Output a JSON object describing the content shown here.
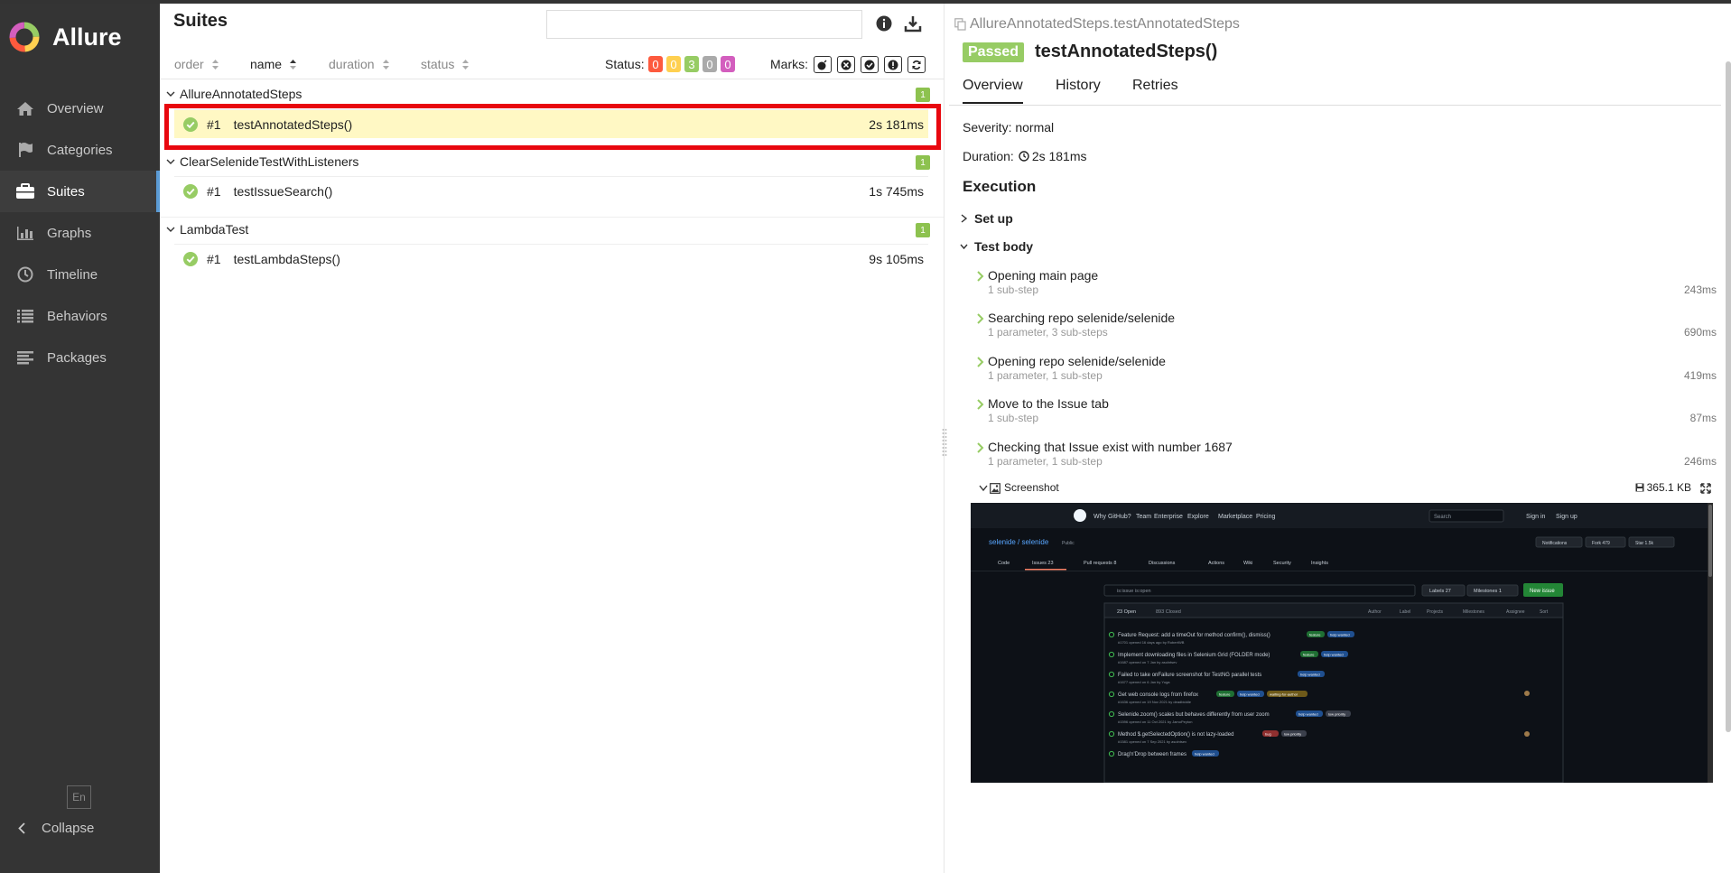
{
  "app": {
    "name": "Allure"
  },
  "sidebar": {
    "items": [
      {
        "label": "Overview",
        "icon": "home-icon",
        "active": false
      },
      {
        "label": "Categories",
        "icon": "flag-icon",
        "active": false
      },
      {
        "label": "Suites",
        "icon": "briefcase-icon",
        "active": true
      },
      {
        "label": "Graphs",
        "icon": "bar-chart-icon",
        "active": false
      },
      {
        "label": "Timeline",
        "icon": "clock-icon",
        "active": false
      },
      {
        "label": "Behaviors",
        "icon": "list-icon",
        "active": false
      },
      {
        "label": "Packages",
        "icon": "align-left-icon",
        "active": false
      }
    ],
    "lang": "En",
    "collapse": "Collapse"
  },
  "suites": {
    "title": "Suites",
    "search_value": "",
    "sort": {
      "order": "order",
      "name": "name",
      "duration": "duration",
      "status": "status"
    },
    "status_label": "Status:",
    "status_counts": [
      {
        "value": "0",
        "color": "#fd5a3e"
      },
      {
        "value": "0",
        "color": "#ffd050"
      },
      {
        "value": "3",
        "color": "#97cc64"
      },
      {
        "value": "0",
        "color": "#aaaaaa"
      },
      {
        "value": "0",
        "color": "#d35ebe"
      }
    ],
    "marks_label": "Marks:",
    "groups": [
      {
        "name": "AllureAnnotatedSteps",
        "count": "1",
        "tests": [
          {
            "num": "#1",
            "name": "testAnnotatedSteps()",
            "duration": "2s 181ms"
          }
        ]
      },
      {
        "name": "ClearSelenideTestWithListeners",
        "count": "1",
        "tests": [
          {
            "num": "#1",
            "name": "testIssueSearch()",
            "duration": "1s 745ms"
          }
        ]
      },
      {
        "name": "LambdaTest",
        "count": "1",
        "tests": [
          {
            "num": "#1",
            "name": "testLambdaSteps()",
            "duration": "9s 105ms"
          }
        ]
      }
    ]
  },
  "detail": {
    "path": "AllureAnnotatedSteps.testAnnotatedSteps",
    "status": "Passed",
    "name": "testAnnotatedSteps()",
    "tabs": [
      "Overview",
      "History",
      "Retries"
    ],
    "severity": "Severity: normal",
    "duration_label": "Duration:",
    "duration": "2s 181ms",
    "execution": "Execution",
    "setup": "Set up",
    "test_body": "Test body",
    "steps": [
      {
        "title": "Opening main page",
        "sub": "1 sub-step",
        "duration": "243ms"
      },
      {
        "title": "Searching repo selenide/selenide",
        "sub": "1 parameter, 3 sub-steps",
        "duration": "690ms"
      },
      {
        "title": "Opening repo selenide/selenide",
        "sub": "1 parameter, 1 sub-step",
        "duration": "419ms"
      },
      {
        "title": "Move to the Issue tab",
        "sub": "1 sub-step",
        "duration": "87ms"
      },
      {
        "title": "Checking that Issue exist with number 1687",
        "sub": "1 parameter, 1 sub-step",
        "duration": "246ms"
      }
    ],
    "attachment": {
      "name": "Screenshot",
      "size": "365.1 KB"
    },
    "screenshot": {
      "nav": [
        "Why GitHub?",
        "Team",
        "Enterprise",
        "Explore",
        "Marketplace",
        "Pricing"
      ],
      "search": "Search",
      "sign_in": "Sign in",
      "sign_up": "Sign up",
      "repo": "selenide / selenide",
      "repo_badge": "Public",
      "repo_actions": [
        "Notifications",
        "Fork 479",
        "Star 1.5k"
      ],
      "tabs": [
        "Code",
        "Issues 23",
        "Pull requests 8",
        "Discussions",
        "Actions",
        "Wiki",
        "Security",
        "Insights"
      ],
      "filter": "is:issue is:open",
      "labels": "Labels 27",
      "milestones": "Milestones 1",
      "new_issue": "New issue",
      "open": "23 Open",
      "closed": "893 Closed",
      "filters": [
        "Author",
        "Label",
        "Projects",
        "Milestones",
        "Assignee",
        "Sort"
      ],
      "issues": [
        {
          "title": "Feature Request: add a timeOut for method confirm(), dismiss()",
          "tags": [
            "feature",
            "help wanted"
          ],
          "meta": "#1701 opened 16 days ago by RobertWB"
        },
        {
          "title": "Implement downloading files in Selenium Grid (FOLDER mode)",
          "tags": [
            "feature",
            "help wanted"
          ],
          "meta": "#1687 opened on 7 Jan by asolntsev"
        },
        {
          "title": "Failed to take onFailure screenshot for TestNG parallel tests",
          "tags": [
            "help wanted"
          ],
          "meta": "#1677 opened on 6 Jan by Yuga"
        },
        {
          "title": "Get web console logs from firefox",
          "tags": [
            "feature",
            "help wanted",
            "waiting-for-author"
          ],
          "meta": "#1636 opened on 19 Nov 2021 by deadbiddle"
        },
        {
          "title": "Selenide.zoom() scales but behaves differently from user zoom",
          "tags": [
            "help wanted",
            "low priority"
          ],
          "meta": "#1596 opened on 11 Oct 2021 by JamoPeyton"
        },
        {
          "title": "Method $.getSelectedOption() is not lazy-loaded",
          "tags": [
            "bug",
            "low priority"
          ],
          "meta": "#1581 opened on 7 Sep 2021 by asolntsev"
        },
        {
          "title": "Drag'n'Drop between frames",
          "tags": [
            "help wanted"
          ],
          "meta": ""
        }
      ]
    }
  }
}
